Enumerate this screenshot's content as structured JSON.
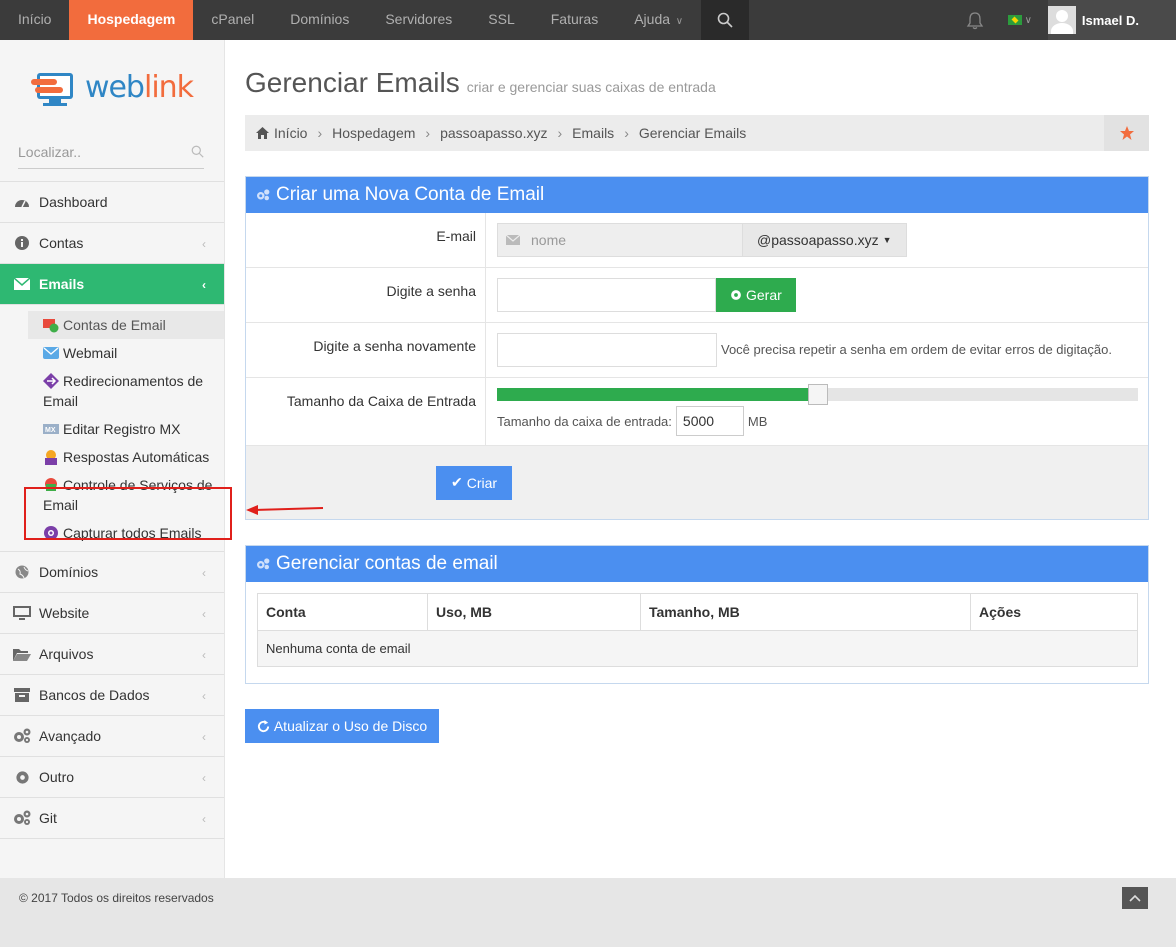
{
  "topnav": {
    "items": [
      "Início",
      "Hospedagem",
      "cPanel",
      "Domínios",
      "Servidores",
      "SSL",
      "Faturas",
      "Ajuda"
    ],
    "user": "Ismael D."
  },
  "sidebar": {
    "logo": {
      "part1": "web",
      "part2": "link"
    },
    "search_placeholder": "Localizar..",
    "items": [
      {
        "label": "Dashboard"
      },
      {
        "label": "Contas"
      },
      {
        "label": "Emails"
      },
      {
        "label": "Domínios"
      },
      {
        "label": "Website"
      },
      {
        "label": "Arquivos"
      },
      {
        "label": "Bancos de Dados"
      },
      {
        "label": "Avançado"
      },
      {
        "label": "Outro"
      },
      {
        "label": "Git"
      }
    ],
    "email_sub": [
      "Contas de Email",
      "Webmail",
      "Redirecionamentos de Email",
      "Editar Registro MX",
      "Respostas Automáticas",
      "Controle de Serviços de Email",
      "Capturar todos Emails"
    ]
  },
  "page": {
    "title": "Gerenciar Emails",
    "subtitle": "criar e gerenciar suas caixas de entrada",
    "breadcrumb": [
      "Início",
      "Hospedagem",
      "passoapasso.xyz",
      "Emails",
      "Gerenciar Emails"
    ]
  },
  "create_panel": {
    "title": "Criar uma Nova Conta de Email",
    "email_label": "E-mail",
    "email_placeholder": "nome",
    "domain": "@passoapasso.xyz",
    "password_label": "Digite a senha",
    "generate_btn": "Gerar",
    "password2_label": "Digite a senha novamente",
    "password2_hint": "Você precisa repetir a senha em ordem de evitar erros de digitação.",
    "mailbox_label": "Tamanho da Caixa de Entrada",
    "mailbox_size_label": "Tamanho da caixa de entrada:",
    "mailbox_size": "5000",
    "mailbox_unit": "MB",
    "mailbox_slider_fraction": 0.5,
    "create_btn": "Criar"
  },
  "manage_panel": {
    "title": "Gerenciar contas de email",
    "columns": [
      "Conta",
      "Uso, MB",
      "Tamanho, MB",
      "Ações"
    ],
    "empty": "Nenhuma conta de email"
  },
  "refresh_btn": "Atualizar o Uso de Disco",
  "footer": "© 2017 Todos os direitos reservados",
  "colors": {
    "brand_orange": "#f26c3d",
    "brand_blue": "#2f86c5",
    "accent_green": "#2eb872",
    "panel_blue": "#4b8ff0"
  }
}
